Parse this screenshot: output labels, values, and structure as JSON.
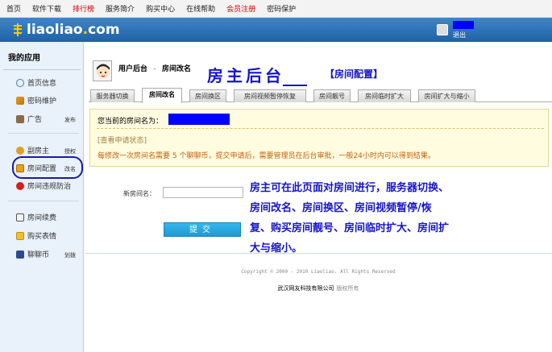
{
  "topnav": {
    "items": [
      "首页",
      "软件下载",
      "排行榜",
      "服务简介",
      "购买中心",
      "在线帮助",
      "会员注册",
      "密码保护"
    ]
  },
  "header": {
    "logo_main": "liaoliao",
    "logo_dot": ".",
    "logo_tld": "com",
    "logout": "退出"
  },
  "sidebar": {
    "title": "我的应用",
    "items": [
      {
        "label": "首页信息",
        "extra": ""
      },
      {
        "label": "密码维护",
        "extra": ""
      },
      {
        "label": "广告",
        "extra": "发布"
      },
      {
        "label": "副房主",
        "extra": "授权"
      },
      {
        "label": "房间配置",
        "extra": "改名"
      },
      {
        "label": "房间违规防治",
        "extra": ""
      },
      {
        "label": "房间续费",
        "extra": ""
      },
      {
        "label": "购买表情",
        "extra": ""
      },
      {
        "label": "聊聊币",
        "extra": "划拨"
      }
    ]
  },
  "breadcrumb": {
    "part1": "用户后台",
    "sep": "-",
    "part2": "房间改名"
  },
  "annotation": {
    "title": "房主后台",
    "subtitle": "【房间配置】",
    "description": "房主可在此页面对房间进行，服务器切换、房间改名、房间换区、房间视频暂停/恢复、购买房间靓号、房间临时扩大、房间扩大与缩小。"
  },
  "tabs": [
    "服务器切换",
    "房间改名",
    "房间换区",
    "房间视频暂停恢复",
    "房间靓号",
    "房间临时扩大",
    "房间扩大与缩小"
  ],
  "active_tab": "房间改名",
  "notice": {
    "current_name_label": "您当前的房间名为：",
    "check_status": "[查看申请状态]",
    "info": "每修改一次房间名需要 5 个聊聊币，提交申请后，需要管理员在后台审批，一般24小时内可以得到结果。"
  },
  "form": {
    "new_name_label": "新房间名：",
    "new_name_value": "",
    "submit_label": "提交"
  },
  "footer": {
    "copyright": "Copyright © 2000 - 2010 Liaoliao. All Rights Reserved",
    "company": "武汉网友科技有限公司",
    "rights": "版权所有"
  },
  "colors": {
    "header_blue": "#2a6fb4",
    "annotation_blue": "#1515c8",
    "hot_red": "#d40000",
    "redaction_blue": "#0000ff",
    "notice_bg": "#fffce0",
    "submit_blue": "#26a8e0"
  }
}
